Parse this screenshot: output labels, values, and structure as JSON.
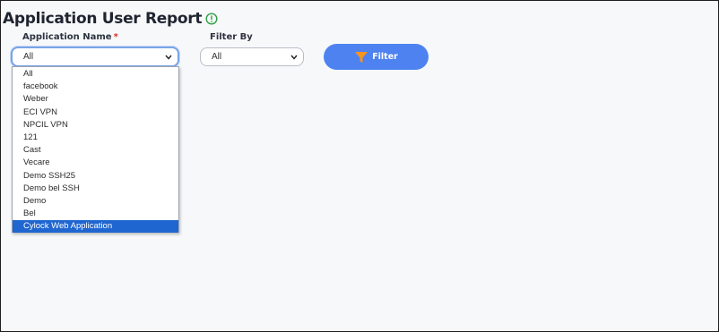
{
  "page": {
    "title": "Application User Report",
    "info_icon": "info-circle-icon",
    "info_icon_color": "#2e9e44"
  },
  "application_field": {
    "label": "Application Name",
    "required_mark": "*",
    "value": "All",
    "chevron_icon": "chevron-down-icon"
  },
  "filter_by_field": {
    "label": "Filter By",
    "value": "All",
    "chevron_icon": "chevron-down-icon"
  },
  "filter_button": {
    "label": "Filter",
    "icon": "funnel-icon",
    "icon_color": "#f7941d",
    "background": "#4d82f0"
  },
  "dropdown": {
    "options": [
      "All",
      "facebook",
      "Weber",
      "ECI VPN",
      "NPCIL VPN",
      "121",
      "Cast",
      "Vecare",
      "Demo SSH25",
      "Demo bel SSH",
      "Demo",
      "Bel",
      "Cylock Web Application"
    ],
    "highlighted": "Cylock Web Application",
    "highlight_color": "#1f66d1"
  }
}
